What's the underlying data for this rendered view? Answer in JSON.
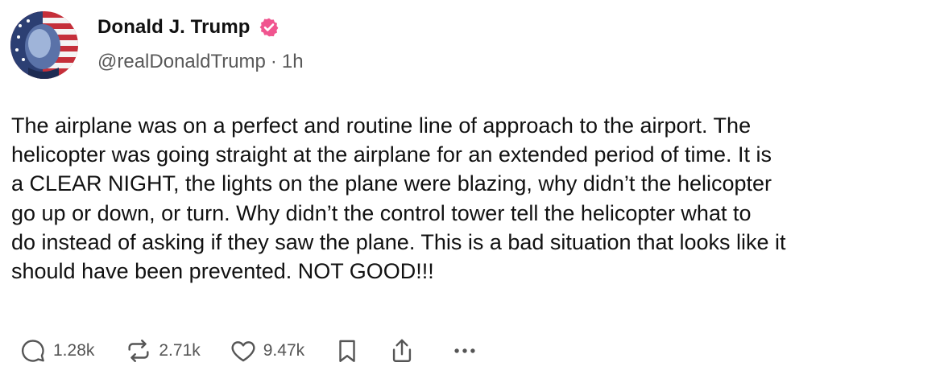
{
  "author": {
    "display_name": "Donald J. Trump",
    "handle": "@realDonaldTrump",
    "separator": "·",
    "time_ago": "1h",
    "verified_icon": "verified-badge-icon",
    "verified_color": "#f0558f"
  },
  "post": {
    "lines": [
      "The airplane was on a perfect and routine line of approach to the airport. The",
      "helicopter was going straight at the airplane for an extended period of time. It is",
      "a CLEAR NIGHT, the lights on the plane were blazing, why didn’t the helicopter",
      "go up or down, or turn. Why didn’t the control tower tell the helicopter what to",
      "do instead of asking if they saw the plane. This is a bad situation that looks like it",
      "should have been prevented. NOT GOOD!!!"
    ]
  },
  "actions": {
    "reply_count": "1.28k",
    "retruth_count": "2.71k",
    "like_count": "9.47k",
    "icons": [
      "reply-icon",
      "retruth-icon",
      "heart-icon",
      "bookmark-icon",
      "share-icon",
      "more-icon"
    ]
  },
  "colors": {
    "text": "#111111",
    "muted": "#595959",
    "action": "#555555",
    "verified": "#f0558f"
  }
}
